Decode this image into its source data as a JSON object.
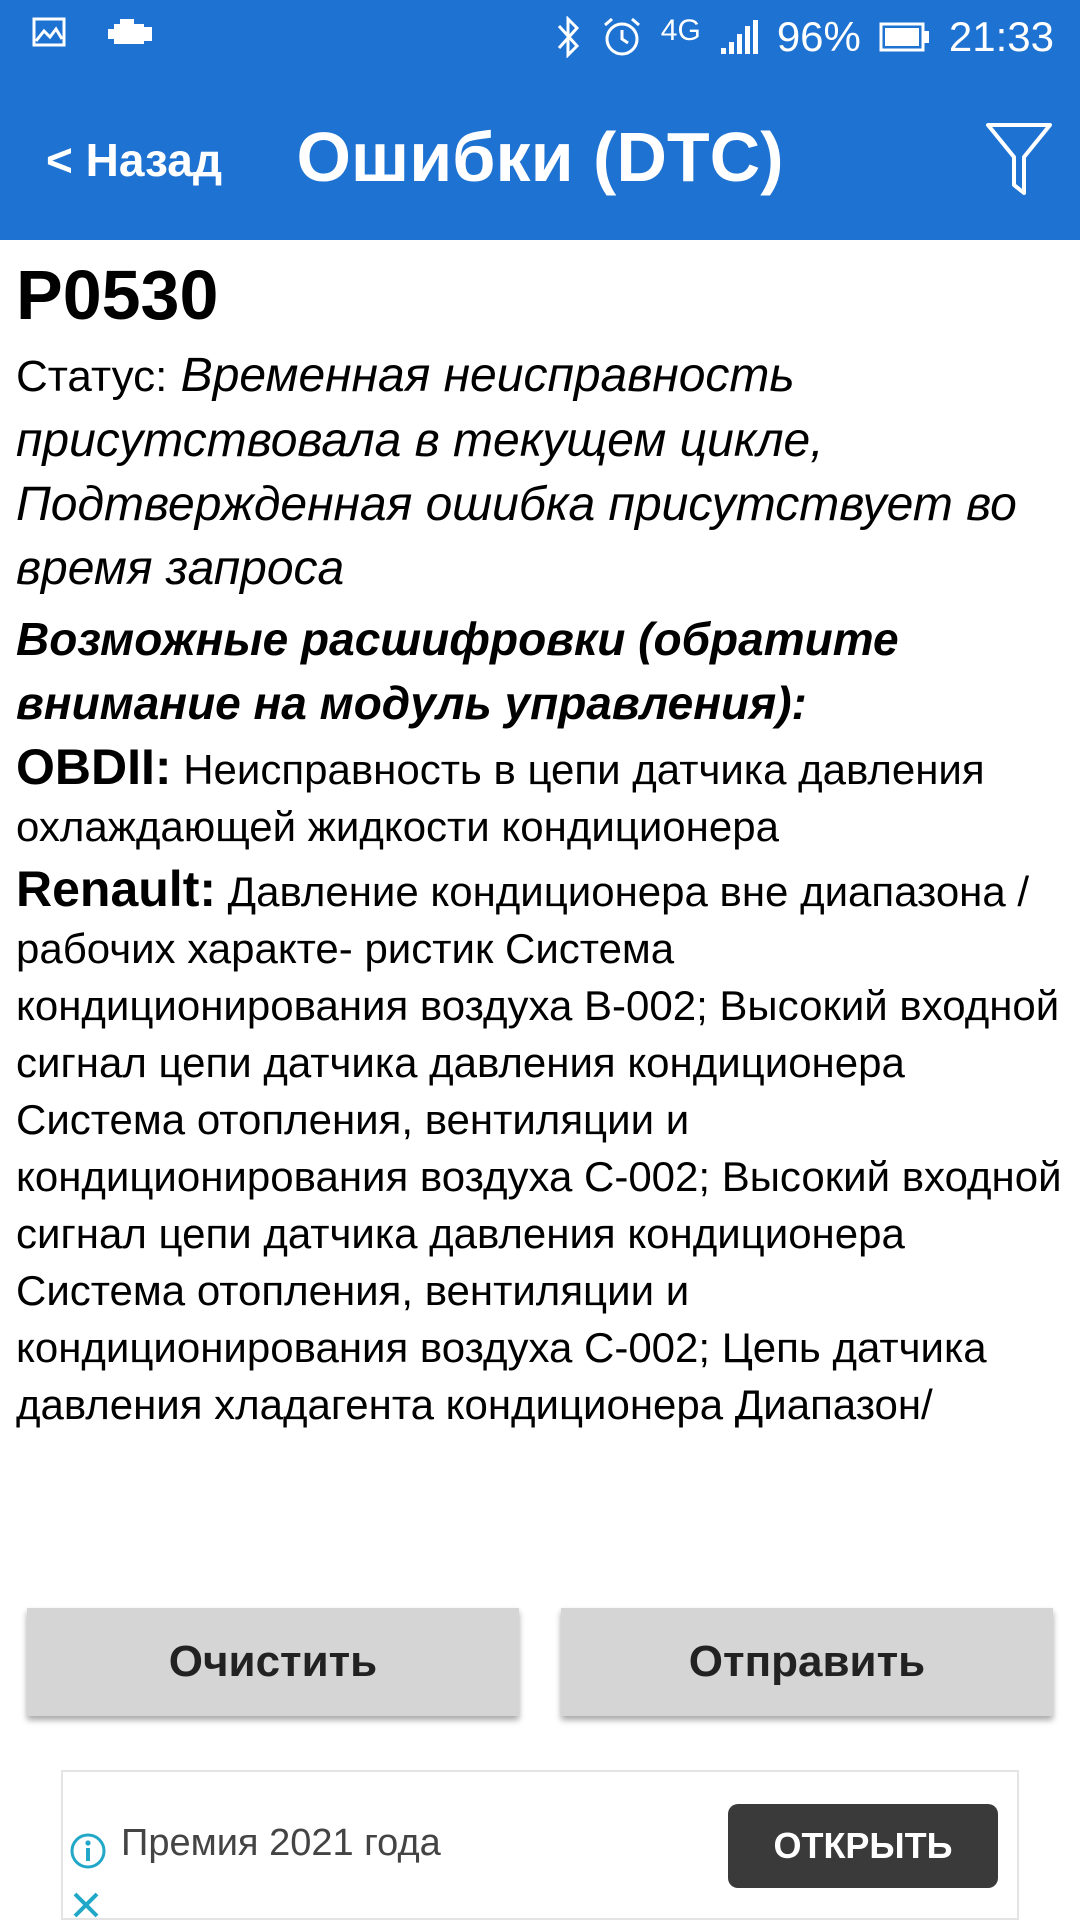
{
  "status_bar": {
    "network": "4G",
    "battery": "96%",
    "time": "21:33",
    "left_icons": [
      "gallery-icon",
      "check-engine-icon"
    ],
    "right_icons": [
      "bluetooth-icon",
      "alarm-icon",
      "signal-icon",
      "battery-icon"
    ]
  },
  "app_bar": {
    "back_label": "< Назад",
    "title": "Ошибки (DTC)",
    "filter_icon": "filter-icon"
  },
  "dtc": {
    "code": "P0530",
    "status_label": "Статус:",
    "status_value": "Временная неисправность присутствовала в текущем цикле, Подтвержденная ошибка присутствует во время запроса",
    "decode_heading": "Возможные расшифровки (обратите внимание на модуль управления):",
    "entries": [
      {
        "make": "OBDII:",
        "text": "Неисправность в цепи датчика давления охлаждающей жидкости кондиционера"
      },
      {
        "make": "Renault:",
        "text": "Давление кондиционера вне диапазона / рабочих характе- ристик Система кондиционирования воздуха В-002; Высокий входной сигнал цепи датчика давления кондиционера Система отопления, вентиляции и кондиционирования воздуха С-002; Высокий входной сигнал цепи датчика давления кондиционера Система отопления, вентиляции и кондиционирования воздуха С-002; Цепь датчика давления хладагента кондиционера Диапазон/"
      }
    ]
  },
  "actions": {
    "clear_label": "Очистить",
    "send_label": "Отправить"
  },
  "ad": {
    "text": "Премия 2021 года",
    "open_label": "ОТКРЫТЬ"
  },
  "colors": {
    "accent": "#1e72d2",
    "button_bg": "#d5d5d5",
    "ad_button_bg": "#3a3a3a",
    "ad_icon": "#21a7c8"
  }
}
